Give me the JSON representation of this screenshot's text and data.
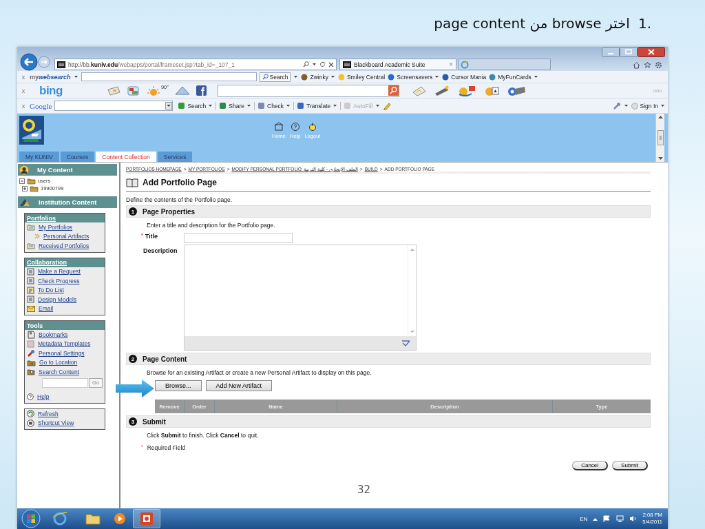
{
  "slide": {
    "step": "1.",
    "title": "اختر browse من page content",
    "page_number": "32"
  },
  "browser": {
    "address": {
      "scheme": "http://bb.",
      "domain": "kuniv.edu",
      "path": "/webapps/portal/frameset.jsp?tab_id=_107_1"
    },
    "tab": {
      "title": "Blackboard Academic Suite",
      "close": "×"
    },
    "mywebsearch": {
      "close": "x",
      "brand_light": "my",
      "brand_bold": "websearch",
      "search_button": "Search",
      "links": [
        {
          "label": "Zwinky",
          "dropdown": true
        },
        {
          "label": "Smiley Central",
          "dropdown": false
        },
        {
          "label": "Screensavers",
          "dropdown": true
        },
        {
          "label": "Cursor Mania",
          "dropdown": false
        },
        {
          "label": "MyFunCards",
          "dropdown": true
        }
      ]
    },
    "bing": {
      "close": "x",
      "logo": "bing",
      "weather": "90°",
      "more": "ooo"
    },
    "google": {
      "close": "x",
      "logo": "Google",
      "buttons": [
        {
          "label": "Search",
          "dropdown": true,
          "disabled": false
        },
        {
          "label": "Share",
          "dropdown": true,
          "disabled": false
        },
        {
          "label": "Check",
          "dropdown": true,
          "disabled": false
        },
        {
          "label": "Translate",
          "dropdown": true,
          "disabled": false
        },
        {
          "label": "AutoFill",
          "dropdown": true,
          "disabled": true
        }
      ],
      "sign_in": "Sign In"
    }
  },
  "blackboard": {
    "header_links": [
      "Home",
      "Help",
      "Logout"
    ],
    "tabs": [
      {
        "label": "My KUNIV",
        "selected": false
      },
      {
        "label": "Courses",
        "selected": false
      },
      {
        "label": "Content Collection",
        "selected": true
      },
      {
        "label": "Services",
        "selected": false
      }
    ],
    "sidebar": {
      "my_content": {
        "title": "My Content",
        "tree": [
          {
            "label": "users",
            "expanded": true,
            "children": [
              {
                "label": "19900799",
                "expanded": false
              }
            ]
          }
        ]
      },
      "institution_content": {
        "title": "Institution Content"
      },
      "boxes": [
        {
          "title": "Portfolios",
          "title_link": true,
          "items": [
            {
              "label": "My Portfolios",
              "kind": "folder"
            },
            {
              "label": "Personal Artifacts",
              "kind": "sub"
            },
            {
              "label": "Received Portfolios",
              "kind": "folder"
            }
          ]
        },
        {
          "title": "Collaboration",
          "title_link": true,
          "items": [
            {
              "label": "Make a Request",
              "kind": "page"
            },
            {
              "label": "Check Progress",
              "kind": "page"
            },
            {
              "label": "To Do List",
              "kind": "todo"
            },
            {
              "label": "Design Models",
              "kind": "page"
            },
            {
              "label": "Email",
              "kind": "mail"
            }
          ]
        },
        {
          "title": "Tools",
          "title_link": false,
          "items": [
            {
              "label": "Bookmarks",
              "kind": "bookmark"
            },
            {
              "label": "Metadata Templates",
              "kind": "template"
            },
            {
              "label": "Personal Settings",
              "kind": "wrench"
            },
            {
              "label": "Go to Location",
              "kind": "location"
            },
            {
              "label": "Search Content",
              "kind": "search"
            },
            {
              "kind": "search-field",
              "button": "Go"
            },
            {
              "label": "Help",
              "kind": "help"
            }
          ]
        },
        {
          "items": [
            {
              "label": "Refresh",
              "kind": "refresh"
            },
            {
              "label": "Shortcut View",
              "kind": "shortcut"
            }
          ]
        }
      ]
    },
    "content": {
      "breadcrumb": [
        {
          "label": "PORTFOLIOS HOMEPAGE",
          "link": true,
          "separator": ">"
        },
        {
          "label": "MY PORTFOLIOS",
          "link": true,
          "separator": ">"
        },
        {
          "label": "MODIFY PERSONAL PORTFOLIO: الملف الإنجازي - كلية التربية",
          "link": true,
          "separator": ">"
        },
        {
          "label": "BUILD",
          "link": true,
          "separator": ">"
        },
        {
          "label": "ADD PORTFOLIO PAGE",
          "link": false
        }
      ],
      "title": "Add Portfolio Page",
      "intro": "Define the contents of the Portfolio page.",
      "sections": [
        {
          "step": "1",
          "title": "Page Properties",
          "kind": "properties",
          "instructions": "Enter a title and description for the Portfolio page.",
          "fields": [
            {
              "label": "Title",
              "required_mark": "*",
              "kind": "text"
            },
            {
              "label": "Description",
              "kind": "textarea"
            }
          ]
        },
        {
          "step": "2",
          "title": "Page Content",
          "kind": "artifacts",
          "instructions": "Browse for an existing Artifact or create a new Personal Artifact to display on this page.",
          "buttons": [
            "Browse...",
            "Add New Artifact"
          ],
          "table_columns": [
            "Remove",
            "Order",
            "Name",
            "Description",
            "Type"
          ]
        },
        {
          "step": "3",
          "title": "Submit",
          "kind": "submit",
          "instructions": "Click **Submit** to finish. Click **Cancel** to quit.",
          "required_note": {
            "mark": "*",
            "text": "Required Field"
          },
          "buttons": [
            "Cancel",
            "Submit"
          ]
        }
      ]
    }
  },
  "taskbar": {
    "language": "EN",
    "time": "2:08 PM",
    "date": "5/4/2011"
  }
}
